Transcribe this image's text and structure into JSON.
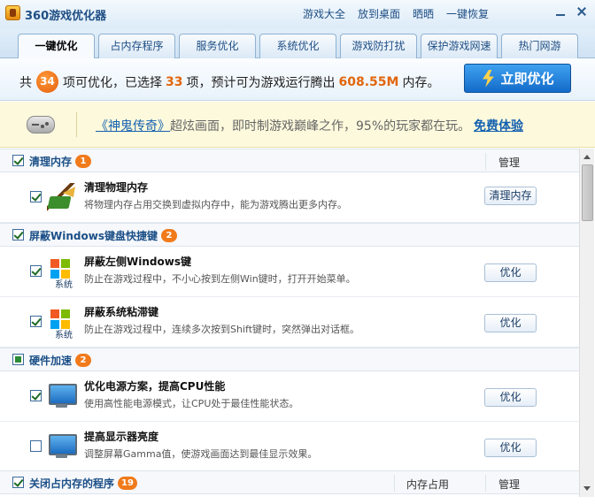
{
  "window": {
    "title": "360游戏优化器"
  },
  "top_links": [
    "游戏大全",
    "放到桌面",
    "晒晒",
    "一键恢复"
  ],
  "tabs": [
    "一键优化",
    "占内存程序",
    "服务优化",
    "系统优化",
    "游戏防打扰",
    "保护游戏网速",
    "热门网游"
  ],
  "summary": {
    "prefix": "共",
    "total": "34",
    "part1": "项可优化，已选择",
    "selected": "33",
    "part2": "项，预计可为游戏运行腾出",
    "memory": "608.55M",
    "part3": "内存。",
    "button": "立即优化"
  },
  "ad": {
    "game_link": "《神鬼传奇》",
    "text": "超炫画面，即时制游戏巅峰之作，95%的玩家都在玩。",
    "cta": "免费体验"
  },
  "sections": [
    {
      "title": "清理内存",
      "count": "1",
      "col_manage": "管理",
      "items": [
        {
          "title": "清理物理内存",
          "desc": "将物理内存占用交换到虚拟内存中，能为游戏腾出更多内存。",
          "button": "清理内存",
          "checked": true,
          "icon": "broom-icon"
        }
      ]
    },
    {
      "title": "屏蔽Windows键盘快捷键",
      "count": "2",
      "items": [
        {
          "title": "屏蔽左侧Windows键",
          "desc": "防止在游戏过程中，不小心按到左侧Win键时，打开开始菜单。",
          "button": "优化",
          "checked": true,
          "icon": "windows-system-icon",
          "icon_text": "系统"
        },
        {
          "title": "屏蔽系统粘滞键",
          "desc": "防止在游戏过程中，连续多次按到Shift键时，突然弹出对话框。",
          "button": "优化",
          "checked": true,
          "icon": "windows-system-icon",
          "icon_text": "系统"
        }
      ]
    },
    {
      "title": "硬件加速",
      "count": "2",
      "items": [
        {
          "title": "优化电源方案，提高CPU性能",
          "desc": "使用高性能电源模式，让CPU处于最佳性能状态。",
          "button": "优化",
          "checked": true,
          "icon": "monitor-icon"
        },
        {
          "title": "提高显示器亮度",
          "desc": "调整屏幕Gamma值，使游戏画面达到最佳显示效果。",
          "button": "优化",
          "checked": false,
          "icon": "monitor-icon"
        }
      ]
    },
    {
      "title": "关闭占内存的程序",
      "count": "19",
      "col_memory": "内存占用",
      "col_manage": "管理"
    }
  ],
  "colors": {
    "accent": "#1360b0",
    "badge": "#f17a1b",
    "highlight": "#e2660c",
    "ad_bg": "#fdf9dc"
  }
}
